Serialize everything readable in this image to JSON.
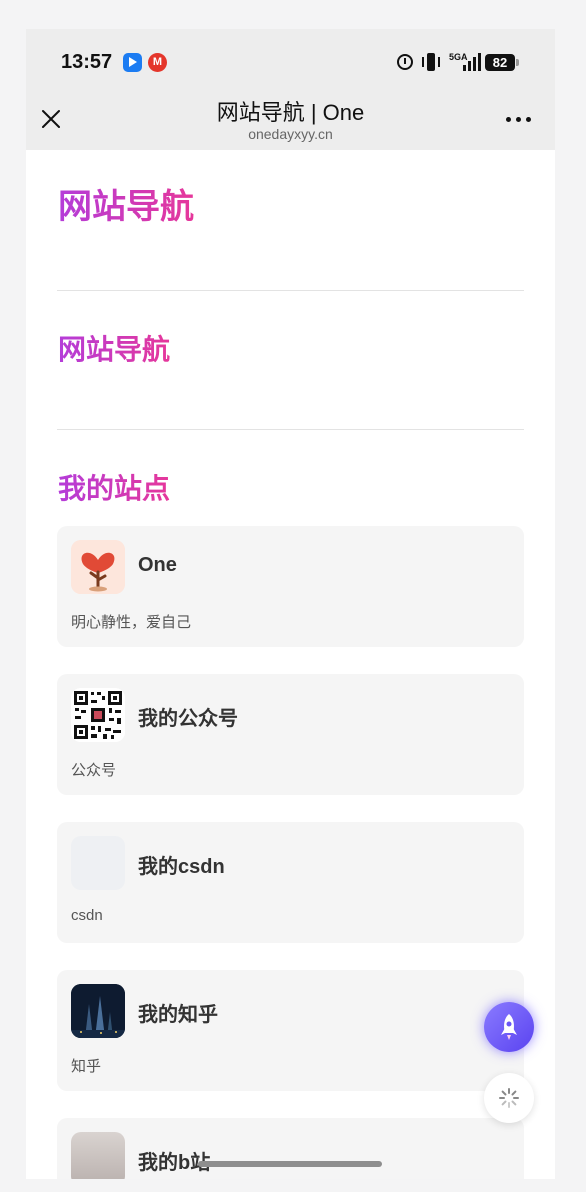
{
  "status_bar": {
    "time": "13:57",
    "notif_icons": [
      "app-blue-arrow-icon",
      "metro-logo-icon"
    ],
    "system_icons": [
      "alarm-icon",
      "vibrate-icon",
      "signal-5g-icon"
    ],
    "signal_label": "5GA",
    "battery_level": "82"
  },
  "nav": {
    "title": "网站导航 | One",
    "subtitle": "onedayxyy.cn",
    "close_icon": "close-icon",
    "more_icon": "more-icon"
  },
  "page": {
    "heading_main": "网站导航",
    "heading_sub": "网站导航",
    "section_title": "我的站点"
  },
  "cards": [
    {
      "title": "One",
      "desc": "明心静性，爱自己",
      "thumb": "tree-logo"
    },
    {
      "title": "我的公众号",
      "desc": "公众号",
      "thumb": "qr-code"
    },
    {
      "title": "我的csdn",
      "desc": "csdn",
      "thumb": "blank"
    },
    {
      "title": "我的知乎",
      "desc": "知乎",
      "thumb": "night-city-photo"
    },
    {
      "title": "我的b站",
      "desc": "",
      "thumb": "avatar-photo"
    }
  ],
  "floating": {
    "rocket_icon": "rocket-icon",
    "loader_icon": "loading-icon"
  },
  "colors": {
    "heading_gradient_start": "#b43cd9",
    "heading_gradient_end": "#e6379a",
    "fab_purple": "#6b55f5",
    "card_bg": "#f5f5f5"
  }
}
